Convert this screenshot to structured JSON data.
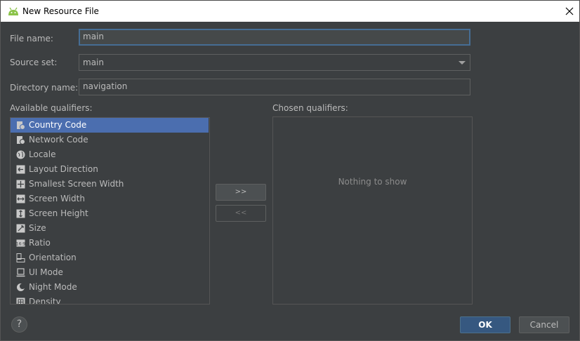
{
  "window": {
    "title": "New Resource File",
    "close_icon": "close-icon",
    "app_icon": "android-icon"
  },
  "form": {
    "file_name_label": "File name:",
    "file_name_value": "main",
    "source_set_label": "Source set:",
    "source_set_value": "main",
    "directory_name_label": "Directory name:",
    "directory_name_value": "navigation"
  },
  "qualifiers": {
    "available_label": "Available qualifiers:",
    "chosen_label": "Chosen qualifiers:",
    "empty_text": "Nothing to show",
    "add_label": ">>",
    "remove_label": "<<",
    "items": [
      {
        "label": "Country Code",
        "icon": "country-code-icon"
      },
      {
        "label": "Network Code",
        "icon": "network-code-icon"
      },
      {
        "label": "Locale",
        "icon": "globe-icon"
      },
      {
        "label": "Layout Direction",
        "icon": "layout-direction-icon"
      },
      {
        "label": "Smallest Screen Width",
        "icon": "smallest-width-icon"
      },
      {
        "label": "Screen Width",
        "icon": "screen-width-icon"
      },
      {
        "label": "Screen Height",
        "icon": "screen-height-icon"
      },
      {
        "label": "Size",
        "icon": "size-icon"
      },
      {
        "label": "Ratio",
        "icon": "ratio-icon"
      },
      {
        "label": "Orientation",
        "icon": "orientation-icon"
      },
      {
        "label": "UI Mode",
        "icon": "ui-mode-icon"
      },
      {
        "label": "Night Mode",
        "icon": "night-mode-icon"
      },
      {
        "label": "Density",
        "icon": "density-icon"
      }
    ]
  },
  "footer": {
    "help_label": "?",
    "ok_label": "OK",
    "cancel_label": "Cancel"
  },
  "colors": {
    "selection": "#4b6eaf",
    "primary_button": "#365880",
    "background": "#3c3f41"
  }
}
